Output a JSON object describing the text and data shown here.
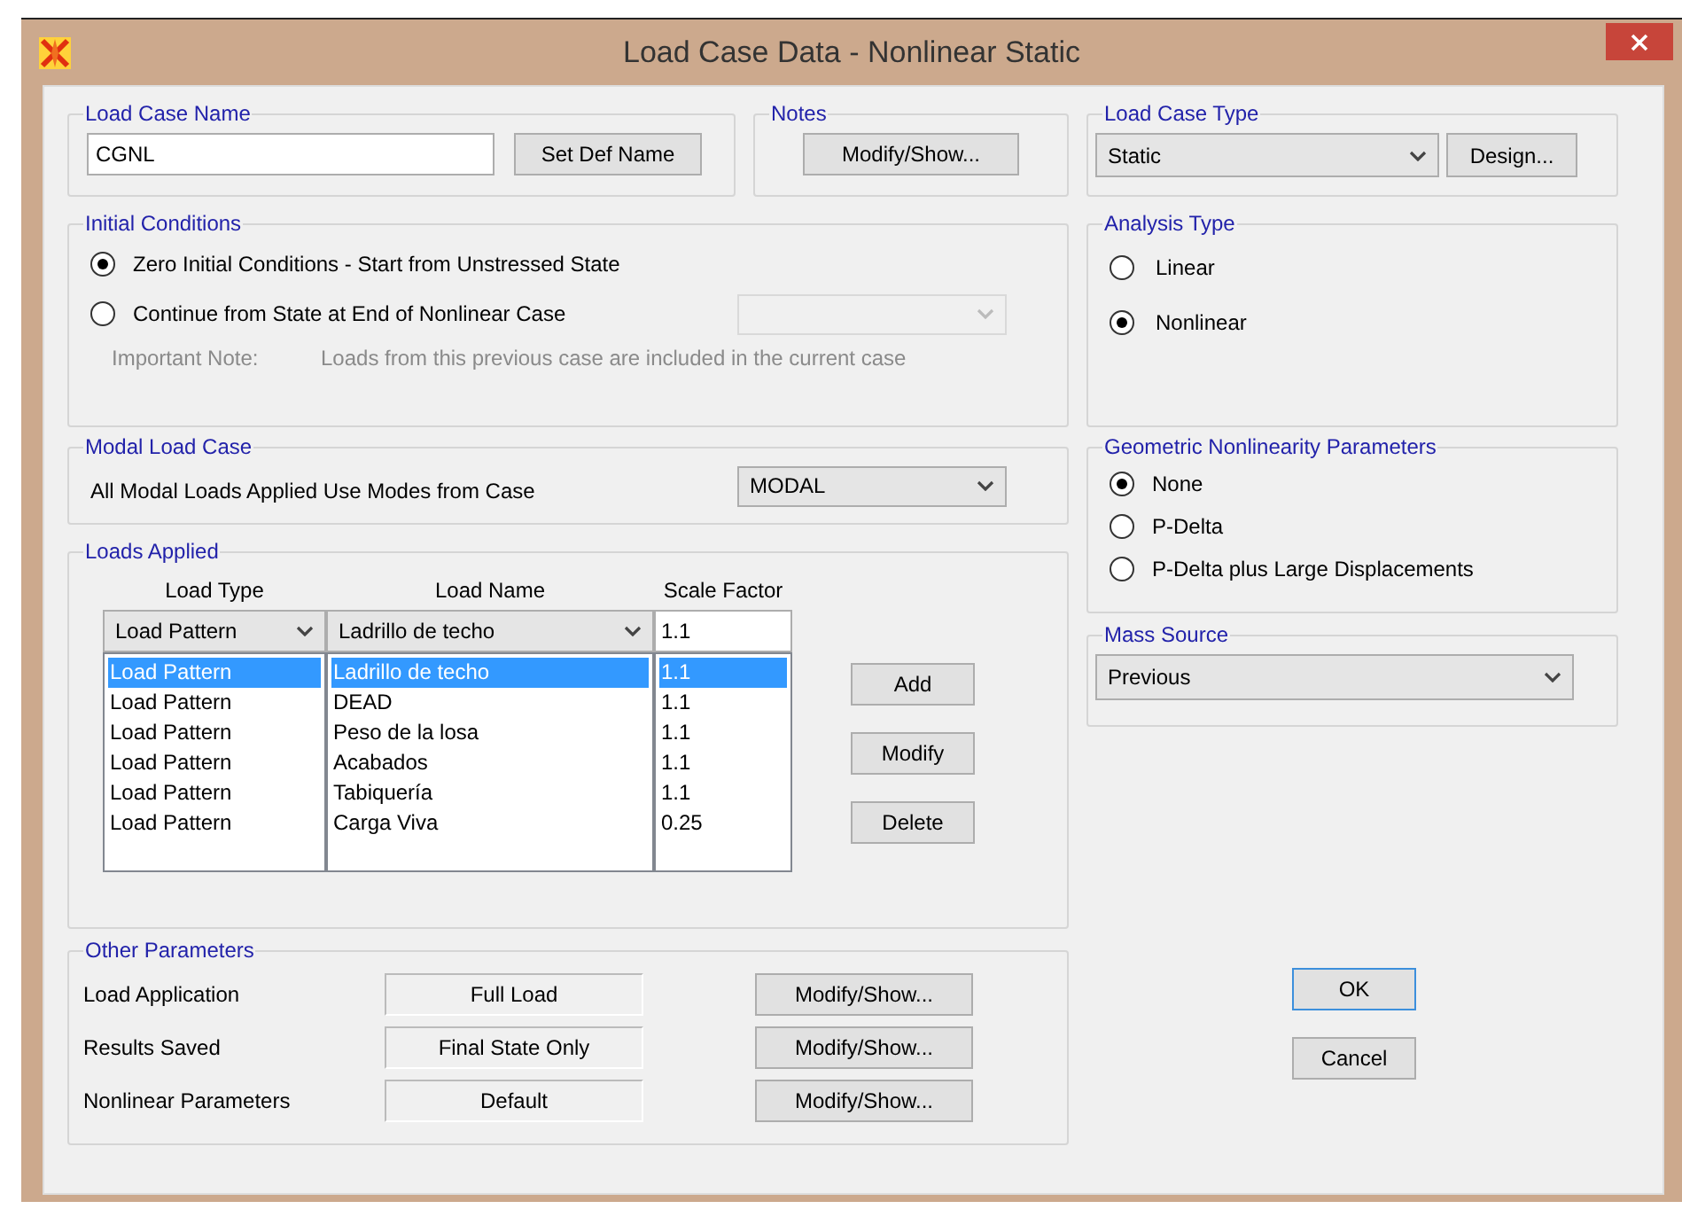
{
  "window": {
    "title": "Load Case Data - Nonlinear Static"
  },
  "load_case_name": {
    "label": "Load Case Name",
    "value": "CGNL",
    "button": "Set Def Name"
  },
  "notes": {
    "label": "Notes",
    "button": "Modify/Show..."
  },
  "load_case_type": {
    "label": "Load Case Type",
    "value": "Static",
    "button": "Design..."
  },
  "initial_conditions": {
    "label": "Initial Conditions",
    "options": [
      {
        "label": "Zero Initial Conditions - Start from Unstressed State",
        "selected": true
      },
      {
        "label": "Continue from State at End of Nonlinear Case",
        "selected": false
      }
    ],
    "case_dropdown": {
      "disabled": true
    },
    "note_label": "Important Note:",
    "note": "Loads from this previous case are included in the current case"
  },
  "analysis_type": {
    "label": "Analysis Type",
    "options": [
      {
        "label": "Linear",
        "selected": false
      },
      {
        "label": "Nonlinear",
        "selected": true
      }
    ]
  },
  "modal_load_case": {
    "label": "Modal Load Case",
    "text": "All Modal Loads Applied Use Modes from Case",
    "value": "MODAL"
  },
  "geometric_nonlinearity": {
    "label": "Geometric Nonlinearity Parameters",
    "options": [
      {
        "label": "None",
        "selected": true
      },
      {
        "label": "P-Delta",
        "selected": false
      },
      {
        "label": "P-Delta plus Large Displacements",
        "selected": false
      }
    ]
  },
  "loads_applied": {
    "label": "Loads Applied",
    "columns": [
      "Load Type",
      "Load Name",
      "Scale Factor"
    ],
    "load_type_value": "Load Pattern",
    "load_name_value": "Ladrillo de techo",
    "scale_factor_value": "1.1",
    "rows": [
      {
        "load_type": "Load Pattern",
        "load_name": "Ladrillo de techo",
        "scale_factor": "1.1",
        "selected": true
      },
      {
        "load_type": "Load Pattern",
        "load_name": "DEAD",
        "scale_factor": "1.1",
        "selected": false
      },
      {
        "load_type": "Load Pattern",
        "load_name": "Peso de la losa",
        "scale_factor": "1.1",
        "selected": false
      },
      {
        "load_type": "Load Pattern",
        "load_name": "Acabados",
        "scale_factor": "1.1",
        "selected": false
      },
      {
        "load_type": "Load Pattern",
        "load_name": "Tabiquería",
        "scale_factor": "1.1",
        "selected": false
      },
      {
        "load_type": "Load Pattern",
        "load_name": "Carga Viva",
        "scale_factor": "0.25",
        "selected": false
      }
    ],
    "buttons": [
      "Add",
      "Modify",
      "Delete"
    ]
  },
  "mass_source": {
    "label": "Mass Source",
    "value": "Previous"
  },
  "other_parameters": {
    "label": "Other Parameters",
    "rows": [
      {
        "label": "Load Application",
        "value": "Full Load",
        "button": "Modify/Show..."
      },
      {
        "label": "Results Saved",
        "value": "Final State Only",
        "button": "Modify/Show..."
      },
      {
        "label": "Nonlinear Parameters",
        "value": "Default",
        "button": "Modify/Show..."
      }
    ]
  },
  "buttons": [
    {
      "label": "OK",
      "default": true
    },
    {
      "label": "Cancel",
      "default": false
    }
  ]
}
